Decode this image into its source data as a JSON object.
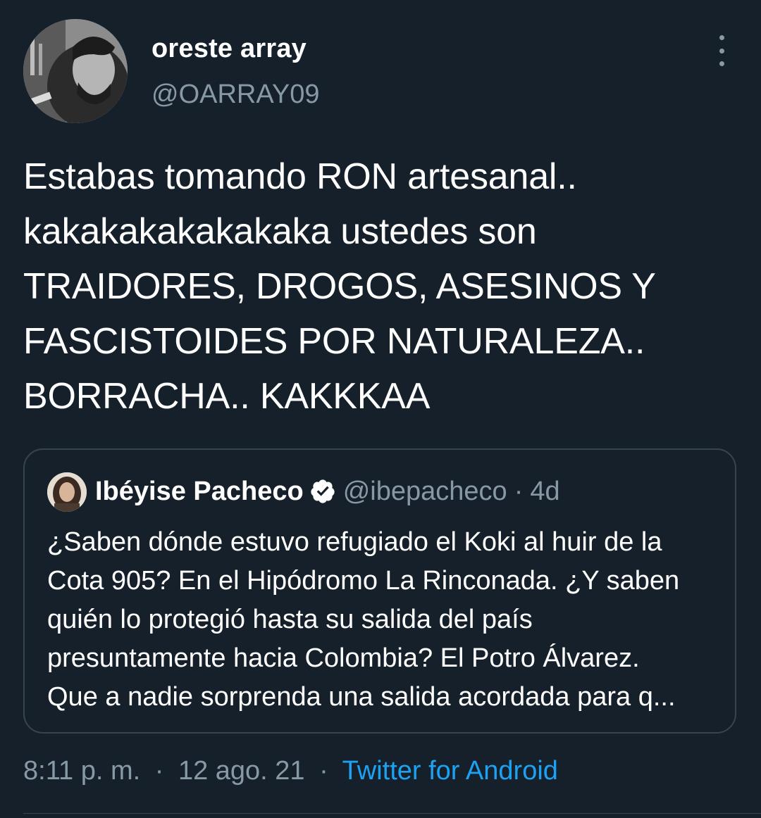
{
  "tweet": {
    "author": {
      "display_name": "oreste array",
      "handle": "@OARRAY09"
    },
    "text": "Estabas tomando RON artesanal..\nkakakakakakakaka ustedes son\nTRAIDORES, DROGOS, ASESINOS Y\nFASCISTOIDES POR NATURALEZA..\nBORRACHA.. KAKKKAA",
    "more_icon": "more-vertical-icon",
    "quoted": {
      "display_name": "Ibéyise Pacheco",
      "verified_icon": "verified-badge-icon",
      "handle": "@ibepacheco",
      "separator": "·",
      "age": "4d",
      "text": "¿Saben dónde estuvo refugiado el Koki al huir de la\nCota 905? En el Hipódromo La Rinconada. ¿Y saben\nquién lo protegió hasta su salida del país\npresuntamente hacia Colombia? El Potro Álvarez.\nQue a nadie sorprenda una salida acordada para q..."
    },
    "meta": {
      "time": "8:11 p. m.",
      "separator": "·",
      "date": "12 ago. 21",
      "source": "Twitter for Android"
    }
  },
  "colors": {
    "background": "#15202b",
    "secondary_text": "#8899a6",
    "accent": "#1da1f2",
    "border": "#38444d"
  }
}
